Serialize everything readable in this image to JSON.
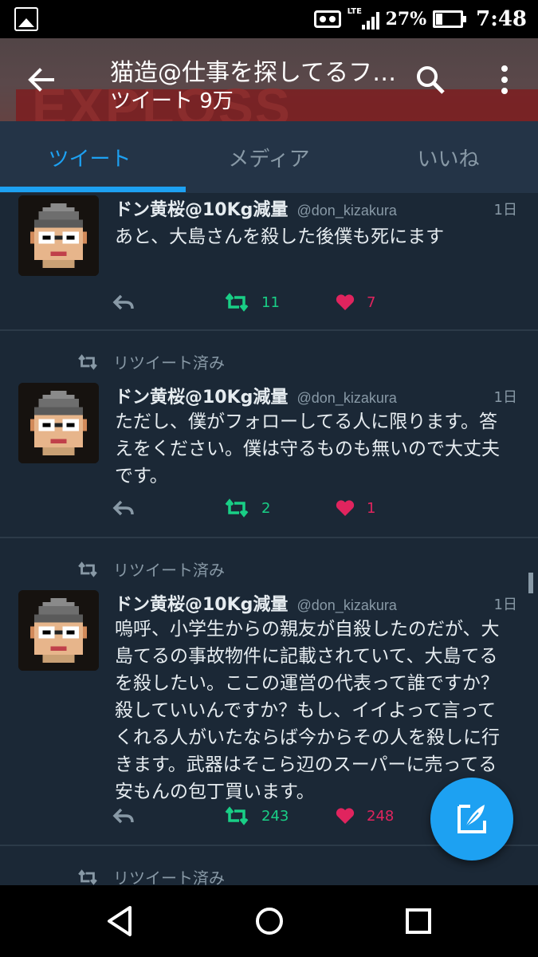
{
  "status_bar": {
    "network": "LTE",
    "battery_percent": "27%",
    "time": "7:48"
  },
  "header": {
    "title": "猫造@仕事を探してるフ…",
    "tweet_count_label": "ツイート 9万",
    "banner_text": "EXPLOSS"
  },
  "tabs": [
    {
      "label": "ツイート",
      "active": true
    },
    {
      "label": "メディア",
      "active": false
    },
    {
      "label": "いいね",
      "active": false
    }
  ],
  "retweet_label": "リツイート済み",
  "tweets": [
    {
      "name": "ドン黄桜@10Kg減量",
      "handle": "@don_kizakura",
      "time": "1日",
      "text": "あと、大島さんを殺した後僕も死にます",
      "retweets": "11",
      "likes": "7"
    },
    {
      "name": "ドン黄桜@10Kg減量",
      "handle": "@don_kizakura",
      "time": "1日",
      "text": "ただし、僕がフォローしてる人に限ります。答えをください。僕は守るものも無いので大丈夫です。",
      "retweets": "2",
      "likes": "1"
    },
    {
      "name": "ドン黄桜@10Kg減量",
      "handle": "@don_kizakura",
      "time": "1日",
      "text": "嗚呼、小学生からの親友が自殺したのだが、大島てるの事故物件に記載されていて、大島てるを殺したい。ここの運営の代表って誰ですか？殺していいんですか？もし、イイよって言ってくれる人がいたならば今からその人を殺しに行きます。武器はそこら辺のスーパーに売ってる安もんの包丁買います。",
      "retweets": "243",
      "likes": "248"
    }
  ],
  "colors": {
    "accent": "#1da1f2",
    "retweet": "#19cf86",
    "like": "#e0245e",
    "background": "#1b2836",
    "tabbar": "#243447"
  }
}
